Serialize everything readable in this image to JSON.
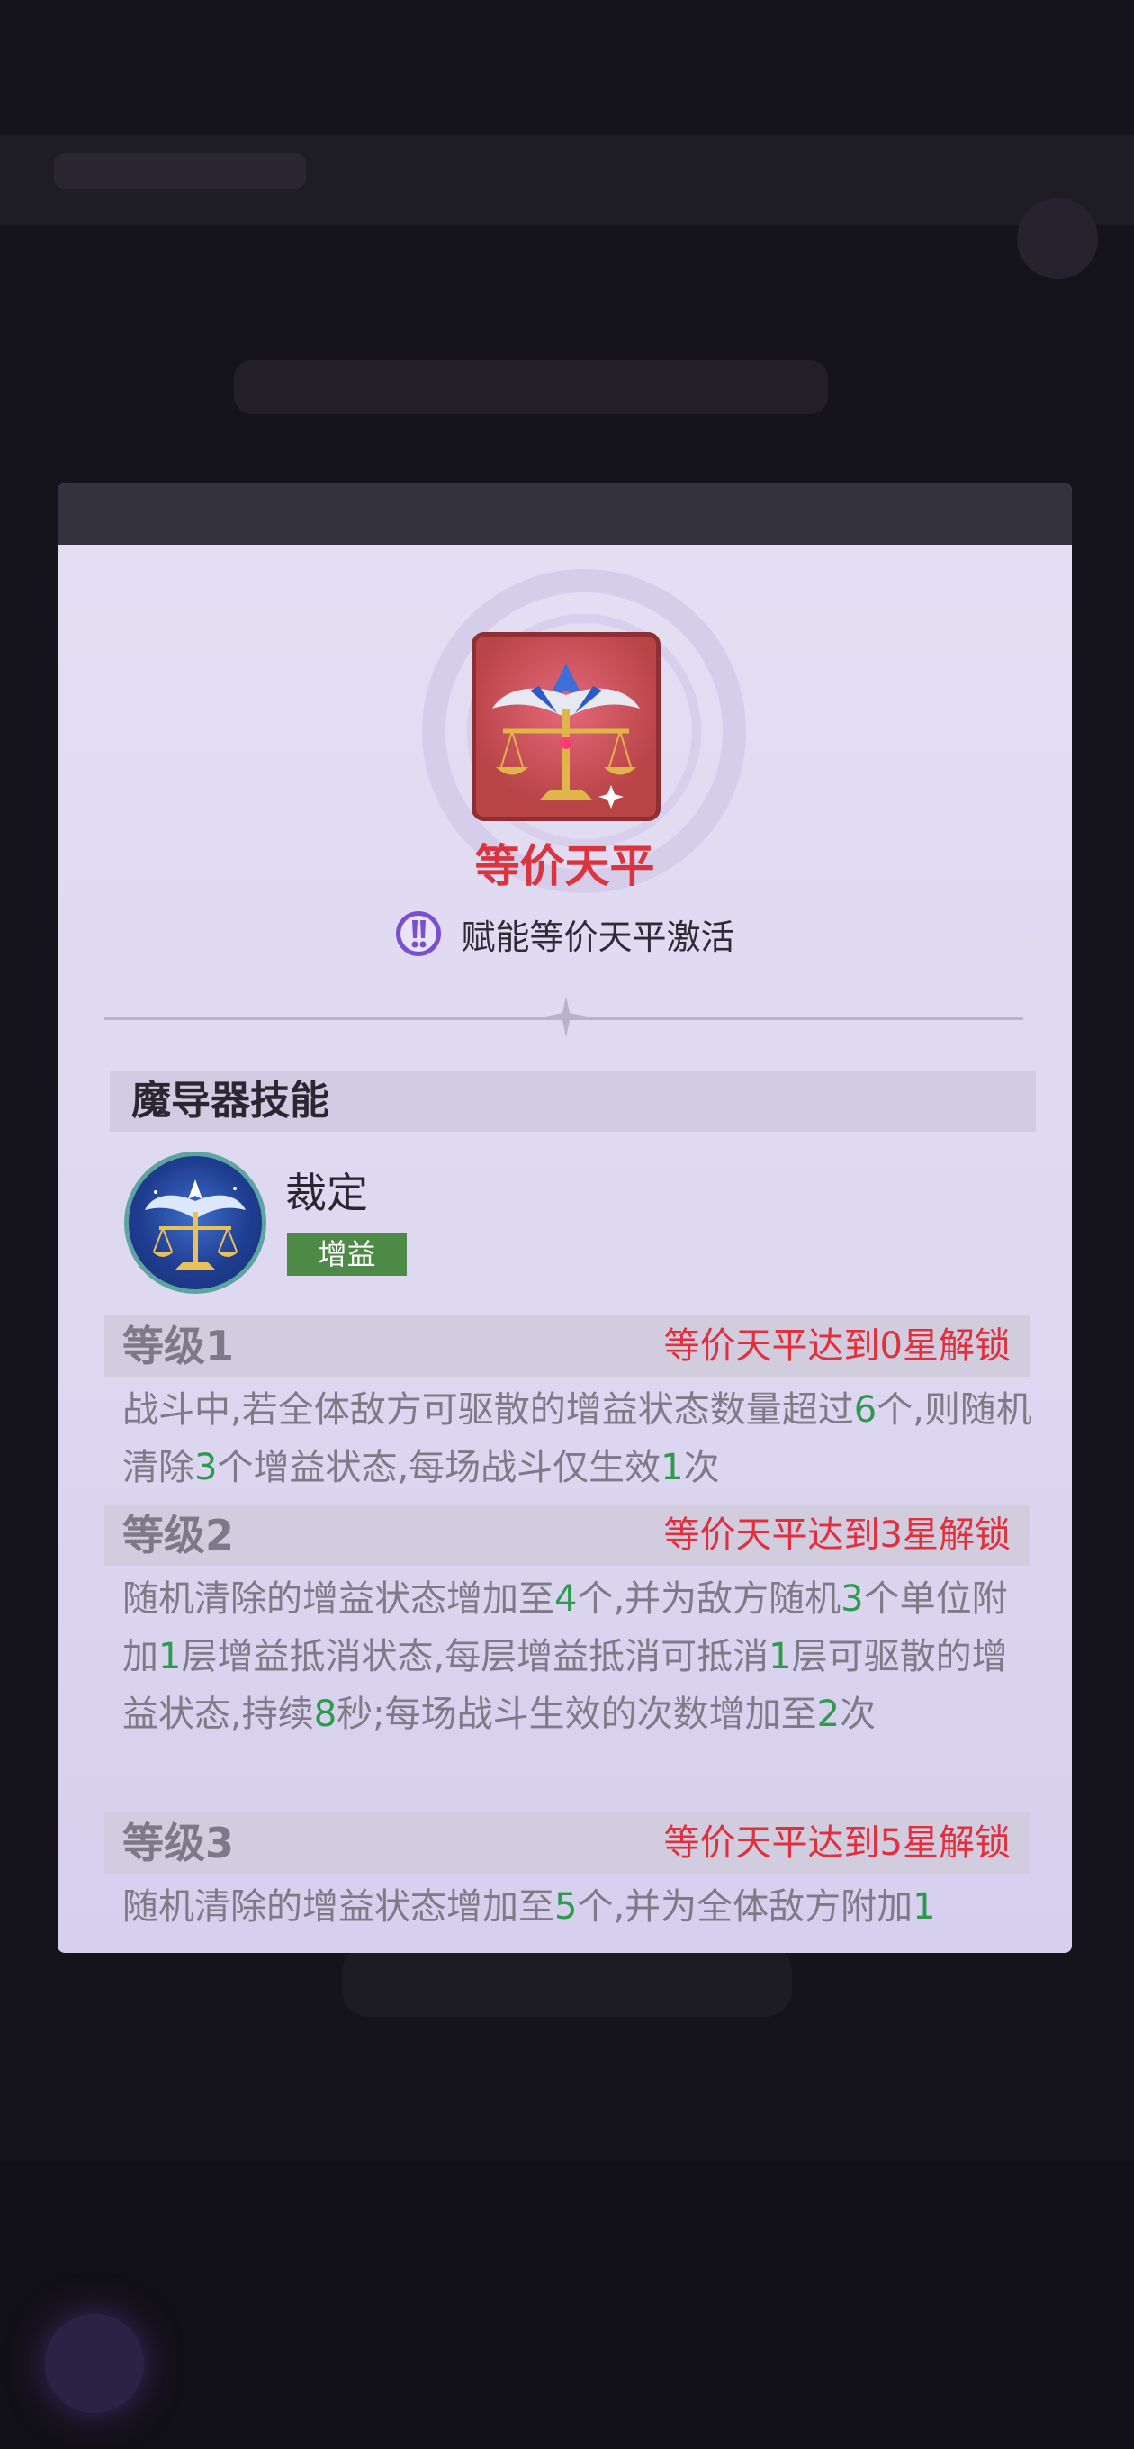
{
  "item": {
    "title": "等价天平",
    "activation_text": "赋能等价天平激活",
    "icon": "libra-scale-icon"
  },
  "skill_section": {
    "heading": "魔导器技能",
    "skill_name": "裁定",
    "skill_tag": "增益",
    "icon": "libra-skill-icon"
  },
  "levels": [
    {
      "label": "等级1",
      "unlock": "等价天平达到0星解锁",
      "segments": [
        "战斗中,若全体敌方可驱散的增益状态数量超过",
        "6",
        "个,则随机清除",
        "3",
        "个增益状态,每场战斗仅生效",
        "1",
        "次"
      ]
    },
    {
      "label": "等级2",
      "unlock": "等价天平达到3星解锁",
      "segments": [
        "随机清除的增益状态增加至",
        "4",
        "个,并为敌方随机",
        "3",
        "个单位附加",
        "1",
        "层增益抵消状态,每层增益抵消可抵消",
        "1",
        "层可驱散的增益状态,持续",
        "8",
        "秒;每场战斗生效的次数增加至",
        "2",
        "次"
      ]
    },
    {
      "label": "等级3",
      "unlock": "等价天平达到5星解锁",
      "segments": [
        "随机清除的增益状态增加至",
        "5",
        "个,并为全体敌方附加",
        "1"
      ]
    }
  ],
  "colors": {
    "title_red": "#d9343f",
    "highlight_green": "#2e9a4e",
    "tag_green": "#4d8a46",
    "activation_purple": "#7a4fd0"
  }
}
